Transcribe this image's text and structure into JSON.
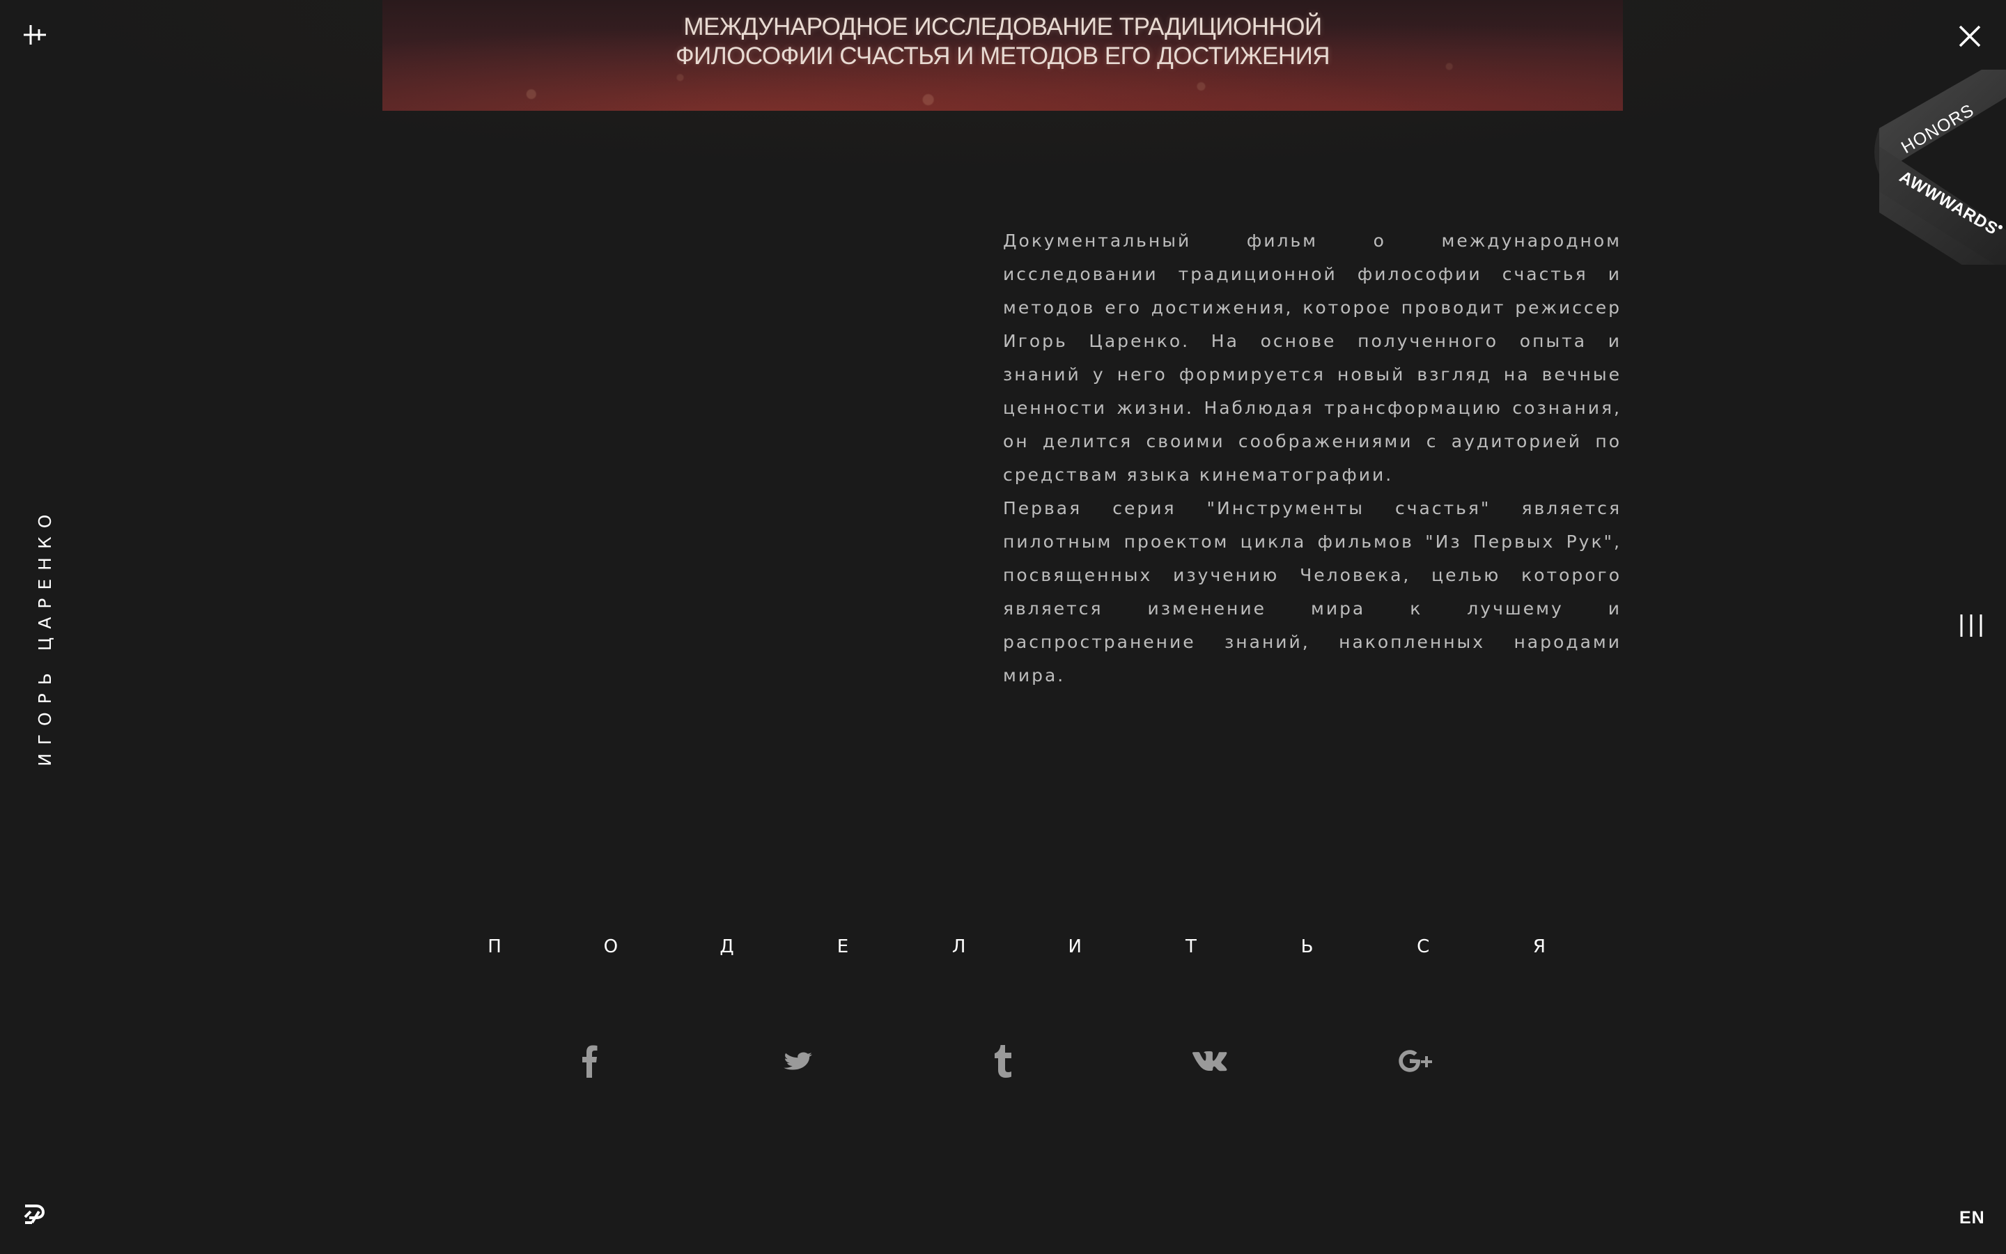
{
  "banner": {
    "title_line1": "МЕЖДУНАРОДНОЕ ИССЛЕДОВАНИЕ ТРАДИЦИОННОЙ",
    "title_line2": "ФИЛОСОФИИ СЧАСТЬЯ И МЕТОДОВ ЕГО ДОСТИЖЕНИЯ"
  },
  "sidebar": {
    "author_name": "ИГОРЬ ЦАРЕНКО"
  },
  "ribbon": {
    "honors": "HONORS",
    "brand": "AWWWARDS"
  },
  "description": {
    "paragraph1": "Документальный фильм о международном исследовании традиционной философии счастья и методов его достижения, которое проводит режиссер Игорь Царенко. На основе полученного опыта и знаний у него формируется новый взгляд на вечные ценности жизни. Наблюдая трансформацию сознания, он делится своими соображениями с аудиторией по средствам языка кинематографии.",
    "paragraph2": "Первая серия \"Инструменты счастья\" является пилотным проектом цикла фильмов \"Из Первых Рук\", посвященных изучению Человека, целью которого является изменение мира к лучшему и распространение знаний, накопленных народами мира."
  },
  "share": {
    "title_letters": [
      "П",
      "О",
      "Д",
      "Е",
      "Л",
      "И",
      "Т",
      "Ь",
      "С",
      "Я"
    ],
    "icons": [
      "facebook-icon",
      "twitter-icon",
      "tumblr-icon",
      "vk-icon",
      "google-plus-icon"
    ]
  },
  "footer": {
    "language": "EN"
  },
  "colors": {
    "background": "#1a1a1a",
    "text": "#bdbdbd",
    "icon": "#9a9a9a",
    "accent": "#4fb7a0"
  }
}
